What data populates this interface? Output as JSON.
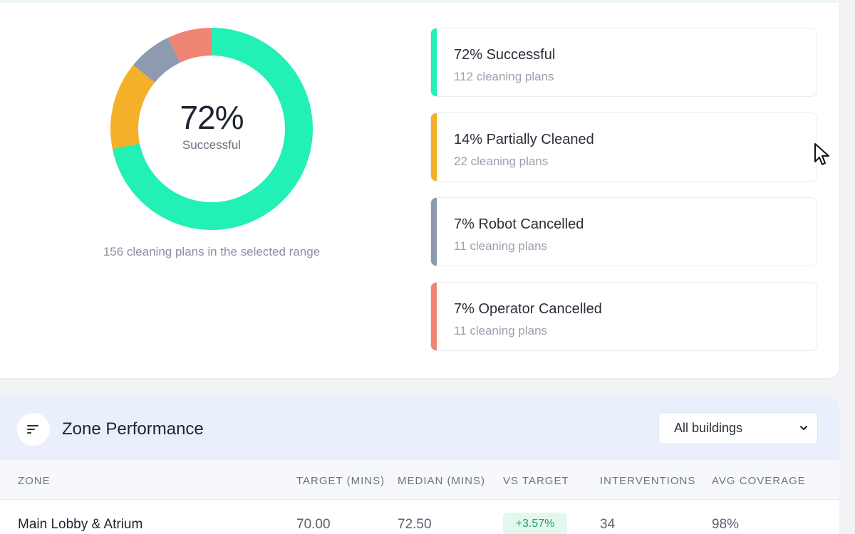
{
  "summary": {
    "donut_value": "72%",
    "donut_label": "Successful",
    "caption": "156 cleaning plans in the selected range",
    "segments": [
      {
        "title": "72% Successful",
        "sub": "112 cleaning plans",
        "count": 112,
        "color": "#22f0b4"
      },
      {
        "title": "14% Partially Cleaned",
        "sub": "22 cleaning plans",
        "count": 22,
        "color": "#f5b02a"
      },
      {
        "title": "7% Robot Cancelled",
        "sub": "11 cleaning plans",
        "count": 11,
        "color": "#8d9ab0"
      },
      {
        "title": "7% Operator Cancelled",
        "sub": "11 cleaning plans",
        "count": 11,
        "color": "#f08474"
      }
    ]
  },
  "zone_performance": {
    "title": "Zone Performance",
    "icon": "sort-lines-icon",
    "filter_value": "All buildings",
    "columns": [
      "ZONE",
      "TARGET (MINS)",
      "MEDIAN (MINS)",
      "VS TARGET",
      "INTERVENTIONS",
      "AVG COVERAGE"
    ],
    "rows": [
      {
        "zone": "Main Lobby & Atrium",
        "target": "70.00",
        "median": "72.50",
        "vs_target": "+3.57%",
        "interventions": "34",
        "coverage": "98%"
      }
    ]
  }
}
